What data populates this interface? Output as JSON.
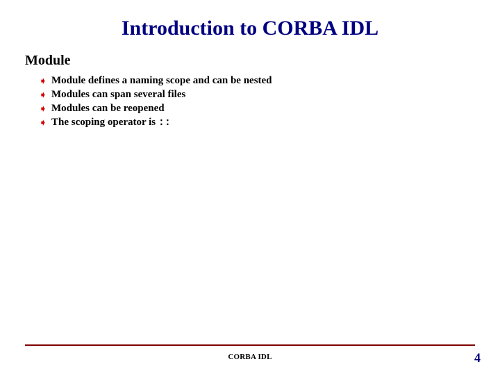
{
  "title": "Introduction to CORBA IDL",
  "subtitle": "Module",
  "bullets": {
    "b0": "Module defines a naming scope and can be nested",
    "b1": "Modules can span several files",
    "b2": "Modules can be reopened",
    "b3_prefix": "The scoping operator is ",
    "b3_op": "::"
  },
  "footer": {
    "label": "CORBA IDL",
    "page": "4"
  }
}
